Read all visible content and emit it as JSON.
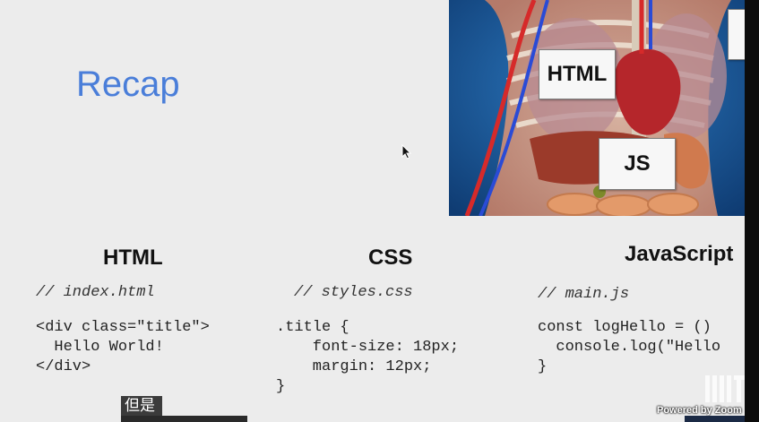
{
  "slide": {
    "title": "Recap",
    "anatomy_labels": {
      "html": "HTML",
      "js": "JS"
    },
    "columns": [
      {
        "heading": "HTML",
        "comment": "// index.html",
        "code": "<div class=\"title\">\n  Hello World!\n</div>"
      },
      {
        "heading": "CSS",
        "comment": "// styles.css",
        "code": ".title {\n    font-size: 18px;\n    margin: 12px;\n}"
      },
      {
        "heading": "JavaScript",
        "comment": "// main.js",
        "code": "const logHello = ()\n  console.log(\"Hello\n}"
      }
    ]
  },
  "overlay": {
    "caption": "但是",
    "watermark": "Powered by Zoom",
    "logo_name": "mit-logo"
  },
  "colors": {
    "title": "#4a7ed9",
    "background": "#ececec"
  }
}
